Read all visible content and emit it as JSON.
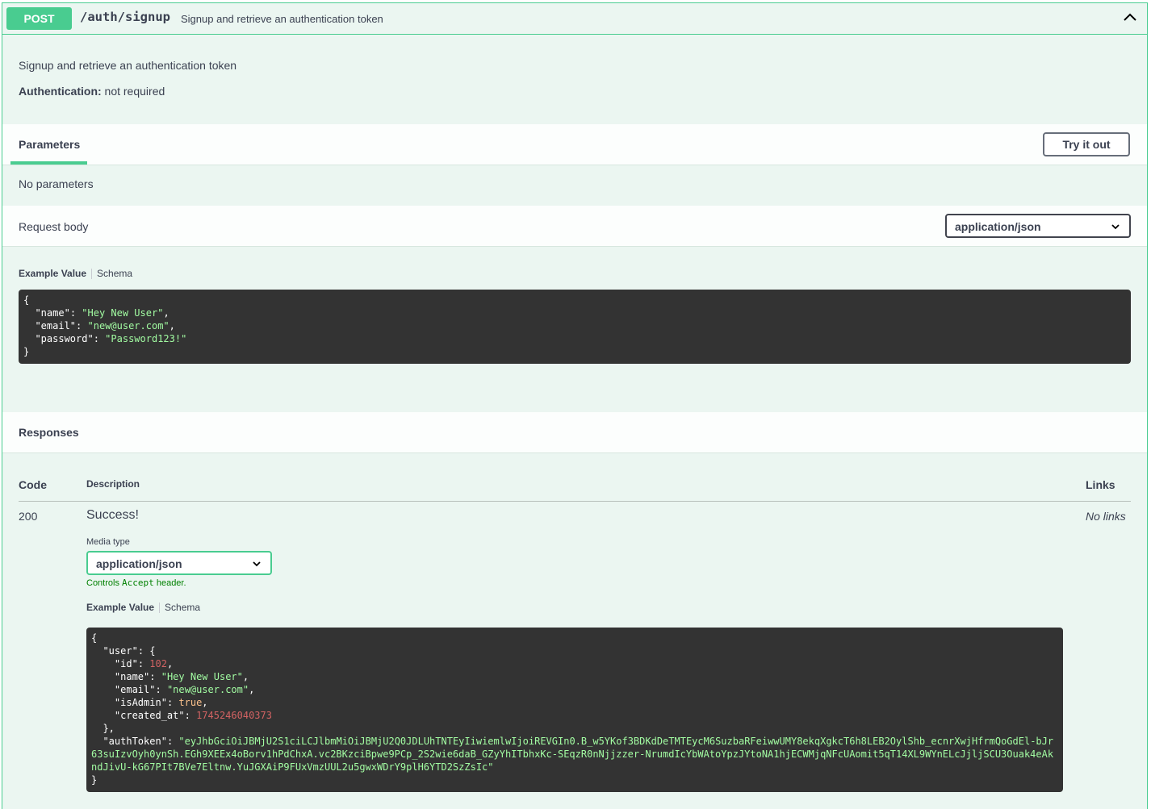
{
  "operation": {
    "method": "POST",
    "path": "/auth/signup",
    "summary": "Signup and retrieve an authentication token",
    "description": "Signup and retrieve an authentication token",
    "auth_label": "Authentication:",
    "auth_value": "not required"
  },
  "parameters": {
    "title": "Parameters",
    "try_button": "Try it out",
    "empty_text": "No parameters"
  },
  "request_body": {
    "title": "Request body",
    "content_type": "application/json",
    "tab_example": "Example Value",
    "tab_schema": "Schema",
    "example": {
      "name": "Hey New User",
      "email": "new@user.com",
      "password": "Password123!"
    }
  },
  "responses": {
    "title": "Responses",
    "columns": {
      "code": "Code",
      "description": "Description",
      "links": "Links"
    },
    "rows": [
      {
        "code": "200",
        "description": "Success!",
        "links": "No links",
        "media_type_label": "Media type",
        "media_type": "application/json",
        "controls_prefix": "Controls ",
        "controls_code": "Accept",
        "controls_suffix": " header.",
        "tab_example": "Example Value",
        "tab_schema": "Schema",
        "example": {
          "user_id": "102",
          "user_name": "Hey New User",
          "user_email": "new@user.com",
          "user_isAdmin": "true",
          "user_created_at": "1745246040373",
          "authToken": "eyJhbGciOiJBMjU2S1ciLCJlbmMiOiJBMjU2Q0JDLUhTNTEyIiwiemlwIjoiREVGIn0.B_w5YKof3BDKdDeTMTEycM6SuzbaRFeiwwUMY8ekqXgkcT6h8LEB2OylShb_ecnrXwjHfrmQoGdEl-bJr63suIzvOyh0ynSh.EGh9XEEx4oBorv1hPdChxA.vc2BKzciBpwe9PCp_2S2wie6daB_GZyYhITbhxKc-SEqzR0nNjjzzer-NrumdIcYbWAtoYpzJYtoNA1hjECWMjqNFcUAomit5qT14XL9WYnELcJjljSCU3Ouak4eAkndJivU-kG67PIt7BVe7Eltnw.YuJGXAiP9FUxVmzUUL2u5gwxWDrY9plH6YTD2SzZsIc"
        }
      }
    ]
  },
  "icons": {
    "collapse": "chevron-up-icon",
    "dropdown": "chevron-down-icon"
  },
  "colors": {
    "post": "#49cc90",
    "post_bg": "#ebf6f1",
    "code_bg": "#333333",
    "string": "#a2fca2",
    "number": "#d36363",
    "bool": "#fcc28c"
  }
}
